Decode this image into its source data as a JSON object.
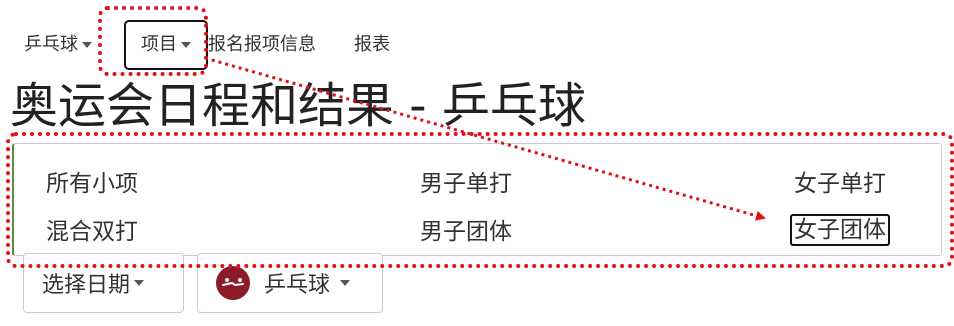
{
  "topnav": {
    "sport": "乒乓球",
    "events": "项目",
    "entries": "报名报项信息",
    "reports": "报表"
  },
  "page_title": "奥运会日程和结果 - 乒乓球",
  "events_menu": {
    "options": [
      "所有小项",
      "男子单打",
      "女子单打",
      "混合双打",
      "男子团体",
      "女子团体"
    ],
    "selected": "女子团体"
  },
  "filters": {
    "date_label": "选择日期",
    "sport_label": "乒乓球",
    "sport_icon": "table-tennis-icon"
  },
  "colors": {
    "annotation": "#e0101a",
    "sport_icon_bg": "#8b1a2b"
  }
}
